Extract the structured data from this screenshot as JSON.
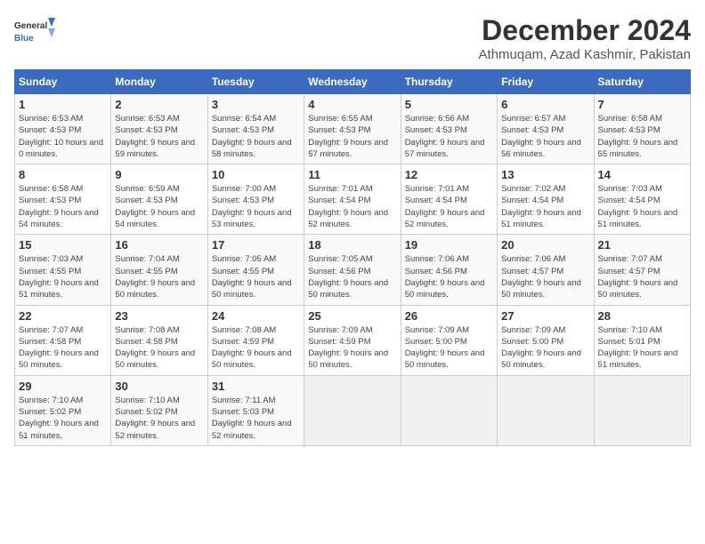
{
  "logo": {
    "line1": "General",
    "line2": "Blue"
  },
  "title": "December 2024",
  "subtitle": "Athmuqam, Azad Kashmir, Pakistan",
  "weekdays": [
    "Sunday",
    "Monday",
    "Tuesday",
    "Wednesday",
    "Thursday",
    "Friday",
    "Saturday"
  ],
  "weeks": [
    [
      {
        "day": "1",
        "sunrise": "6:53 AM",
        "sunset": "4:53 PM",
        "daylight": "10 hours and 0 minutes."
      },
      {
        "day": "2",
        "sunrise": "6:53 AM",
        "sunset": "4:53 PM",
        "daylight": "9 hours and 59 minutes."
      },
      {
        "day": "3",
        "sunrise": "6:54 AM",
        "sunset": "4:53 PM",
        "daylight": "9 hours and 58 minutes."
      },
      {
        "day": "4",
        "sunrise": "6:55 AM",
        "sunset": "4:53 PM",
        "daylight": "9 hours and 57 minutes."
      },
      {
        "day": "5",
        "sunrise": "6:56 AM",
        "sunset": "4:53 PM",
        "daylight": "9 hours and 57 minutes."
      },
      {
        "day": "6",
        "sunrise": "6:57 AM",
        "sunset": "4:53 PM",
        "daylight": "9 hours and 56 minutes."
      },
      {
        "day": "7",
        "sunrise": "6:58 AM",
        "sunset": "4:53 PM",
        "daylight": "9 hours and 55 minutes."
      }
    ],
    [
      {
        "day": "8",
        "sunrise": "6:58 AM",
        "sunset": "4:53 PM",
        "daylight": "9 hours and 54 minutes."
      },
      {
        "day": "9",
        "sunrise": "6:59 AM",
        "sunset": "4:53 PM",
        "daylight": "9 hours and 54 minutes."
      },
      {
        "day": "10",
        "sunrise": "7:00 AM",
        "sunset": "4:53 PM",
        "daylight": "9 hours and 53 minutes."
      },
      {
        "day": "11",
        "sunrise": "7:01 AM",
        "sunset": "4:54 PM",
        "daylight": "9 hours and 52 minutes."
      },
      {
        "day": "12",
        "sunrise": "7:01 AM",
        "sunset": "4:54 PM",
        "daylight": "9 hours and 52 minutes."
      },
      {
        "day": "13",
        "sunrise": "7:02 AM",
        "sunset": "4:54 PM",
        "daylight": "9 hours and 51 minutes."
      },
      {
        "day": "14",
        "sunrise": "7:03 AM",
        "sunset": "4:54 PM",
        "daylight": "9 hours and 51 minutes."
      }
    ],
    [
      {
        "day": "15",
        "sunrise": "7:03 AM",
        "sunset": "4:55 PM",
        "daylight": "9 hours and 51 minutes."
      },
      {
        "day": "16",
        "sunrise": "7:04 AM",
        "sunset": "4:55 PM",
        "daylight": "9 hours and 50 minutes."
      },
      {
        "day": "17",
        "sunrise": "7:05 AM",
        "sunset": "4:55 PM",
        "daylight": "9 hours and 50 minutes."
      },
      {
        "day": "18",
        "sunrise": "7:05 AM",
        "sunset": "4:56 PM",
        "daylight": "9 hours and 50 minutes."
      },
      {
        "day": "19",
        "sunrise": "7:06 AM",
        "sunset": "4:56 PM",
        "daylight": "9 hours and 50 minutes."
      },
      {
        "day": "20",
        "sunrise": "7:06 AM",
        "sunset": "4:57 PM",
        "daylight": "9 hours and 50 minutes."
      },
      {
        "day": "21",
        "sunrise": "7:07 AM",
        "sunset": "4:57 PM",
        "daylight": "9 hours and 50 minutes."
      }
    ],
    [
      {
        "day": "22",
        "sunrise": "7:07 AM",
        "sunset": "4:58 PM",
        "daylight": "9 hours and 50 minutes."
      },
      {
        "day": "23",
        "sunrise": "7:08 AM",
        "sunset": "4:58 PM",
        "daylight": "9 hours and 50 minutes."
      },
      {
        "day": "24",
        "sunrise": "7:08 AM",
        "sunset": "4:59 PM",
        "daylight": "9 hours and 50 minutes."
      },
      {
        "day": "25",
        "sunrise": "7:09 AM",
        "sunset": "4:59 PM",
        "daylight": "9 hours and 50 minutes."
      },
      {
        "day": "26",
        "sunrise": "7:09 AM",
        "sunset": "5:00 PM",
        "daylight": "9 hours and 50 minutes."
      },
      {
        "day": "27",
        "sunrise": "7:09 AM",
        "sunset": "5:00 PM",
        "daylight": "9 hours and 50 minutes."
      },
      {
        "day": "28",
        "sunrise": "7:10 AM",
        "sunset": "5:01 PM",
        "daylight": "9 hours and 51 minutes."
      }
    ],
    [
      {
        "day": "29",
        "sunrise": "7:10 AM",
        "sunset": "5:02 PM",
        "daylight": "9 hours and 51 minutes."
      },
      {
        "day": "30",
        "sunrise": "7:10 AM",
        "sunset": "5:02 PM",
        "daylight": "9 hours and 52 minutes."
      },
      {
        "day": "31",
        "sunrise": "7:11 AM",
        "sunset": "5:03 PM",
        "daylight": "9 hours and 52 minutes."
      },
      null,
      null,
      null,
      null
    ]
  ]
}
